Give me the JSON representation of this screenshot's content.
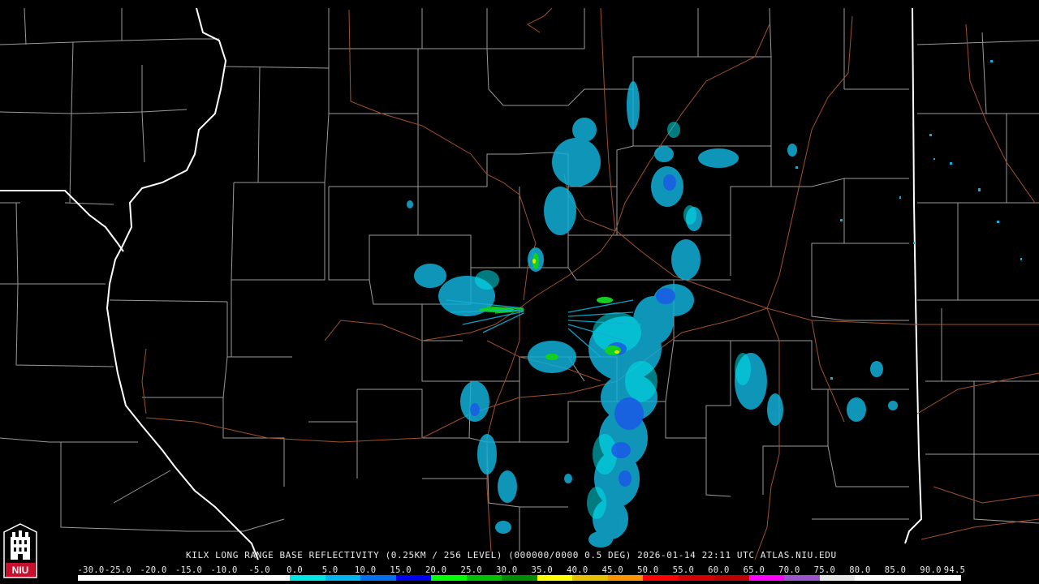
{
  "caption": "KILX LONG RANGE BASE REFLECTIVITY (0.25KM / 256 LEVEL) (000000/0000 0.5 DEG) 2026-01-14 22:11 UTC  ATLAS.NIU.EDU",
  "scale_labels": [
    "-30.0",
    "-25.0",
    "-20.0",
    "-15.0",
    "-10.0",
    "-5.0",
    "0.0",
    "5.0",
    "10.0",
    "15.0",
    "20.0",
    "25.0",
    "30.0",
    "35.0",
    "40.0",
    "45.0",
    "50.0",
    "55.0",
    "60.0",
    "65.0",
    "70.0",
    "75.0",
    "80.0",
    "85.0",
    "90.0",
    "94.5"
  ],
  "scale_colors": [
    "#ffffff",
    "#ffffff",
    "#ffffff",
    "#ffffff",
    "#ffffff",
    "#ffffff",
    "#00e5e5",
    "#00b4f0",
    "#0070f0",
    "#0000f0",
    "#00ff00",
    "#00c000",
    "#008c00",
    "#ffff00",
    "#e6c000",
    "#ff9000",
    "#ff0000",
    "#d40000",
    "#be0000",
    "#ff00ff",
    "#9955c9",
    "#e8e8e8",
    "#ffffff",
    "#ffffff",
    "#ffffff"
  ],
  "logo": {
    "text": "NIU",
    "colors": {
      "red": "#c8102e",
      "white": "#ffffff",
      "black": "#000000"
    }
  },
  "map_colors": {
    "county_lines": "#9a9a9a",
    "state_lines": "#ffffff",
    "highways": "#a0522d",
    "echo_light": "#12b0d8",
    "echo_cyan": "#00e0e8",
    "echo_blue": "#1a5ae8",
    "echo_green": "#12d020",
    "echo_yellow": "#e6e600"
  }
}
